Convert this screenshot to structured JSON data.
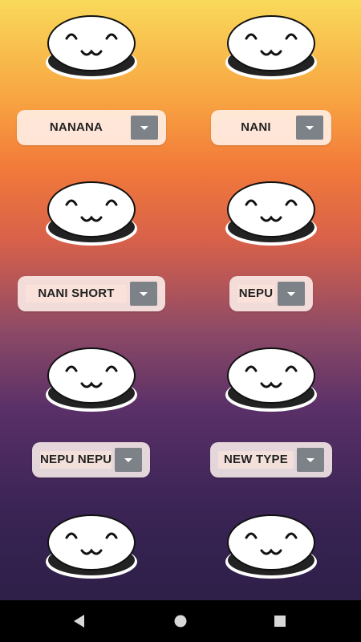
{
  "buttons": [
    {
      "label": "NANANA"
    },
    {
      "label": "NANI"
    },
    {
      "label": "NANI SHORT"
    },
    {
      "label": "NEPU"
    },
    {
      "label": "NEPU NEPU"
    },
    {
      "label": "NEW TYPE"
    }
  ],
  "navbar": {
    "icons": [
      "back-icon",
      "home-icon",
      "recents-icon"
    ]
  },
  "colors": {
    "dropdown": "#7d8288",
    "selector_bg": "#fff5f0"
  }
}
